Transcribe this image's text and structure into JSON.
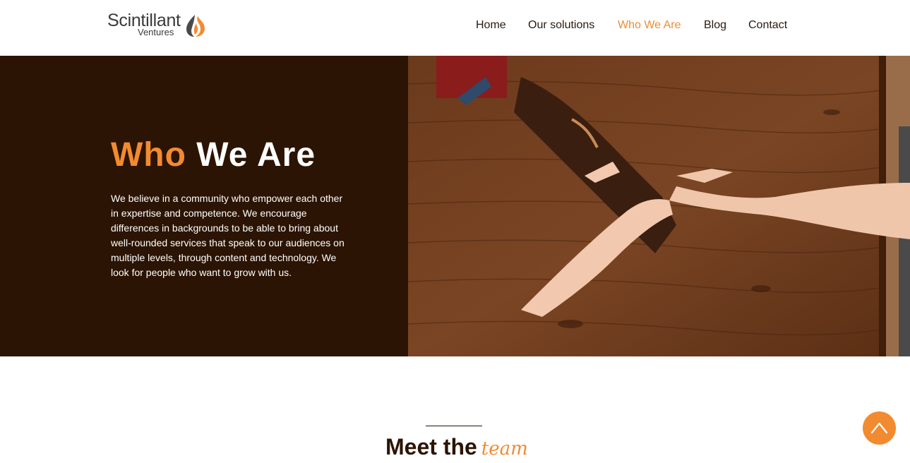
{
  "header": {
    "logo": {
      "main": "Scintillant",
      "sub": "Ventures",
      "flame_colors": [
        "#f28b30",
        "#4a4a4a"
      ]
    },
    "nav": [
      {
        "label": "Home",
        "active": false
      },
      {
        "label": "Our solutions",
        "active": false
      },
      {
        "label": "Who We Are",
        "active": true
      },
      {
        "label": "Blog",
        "active": false
      },
      {
        "label": "Contact",
        "active": false
      }
    ]
  },
  "hero": {
    "title_accent": "Who",
    "title_rest": "We Are",
    "text": "We believe in a community who empower each other in expertise and competence. We encourage differences in backgrounds to be able to bring about well-rounded services that speak to our audiences on multiple levels, through content and technology. We look for people who want to grow with us.",
    "image": "hands-on-wooden-table",
    "background_color": "#2b1403",
    "accent_color": "#f28b30"
  },
  "team": {
    "heading_main": "Meet the",
    "heading_script": "team"
  },
  "scroll_top": {
    "icon": "chevron-up-icon"
  }
}
